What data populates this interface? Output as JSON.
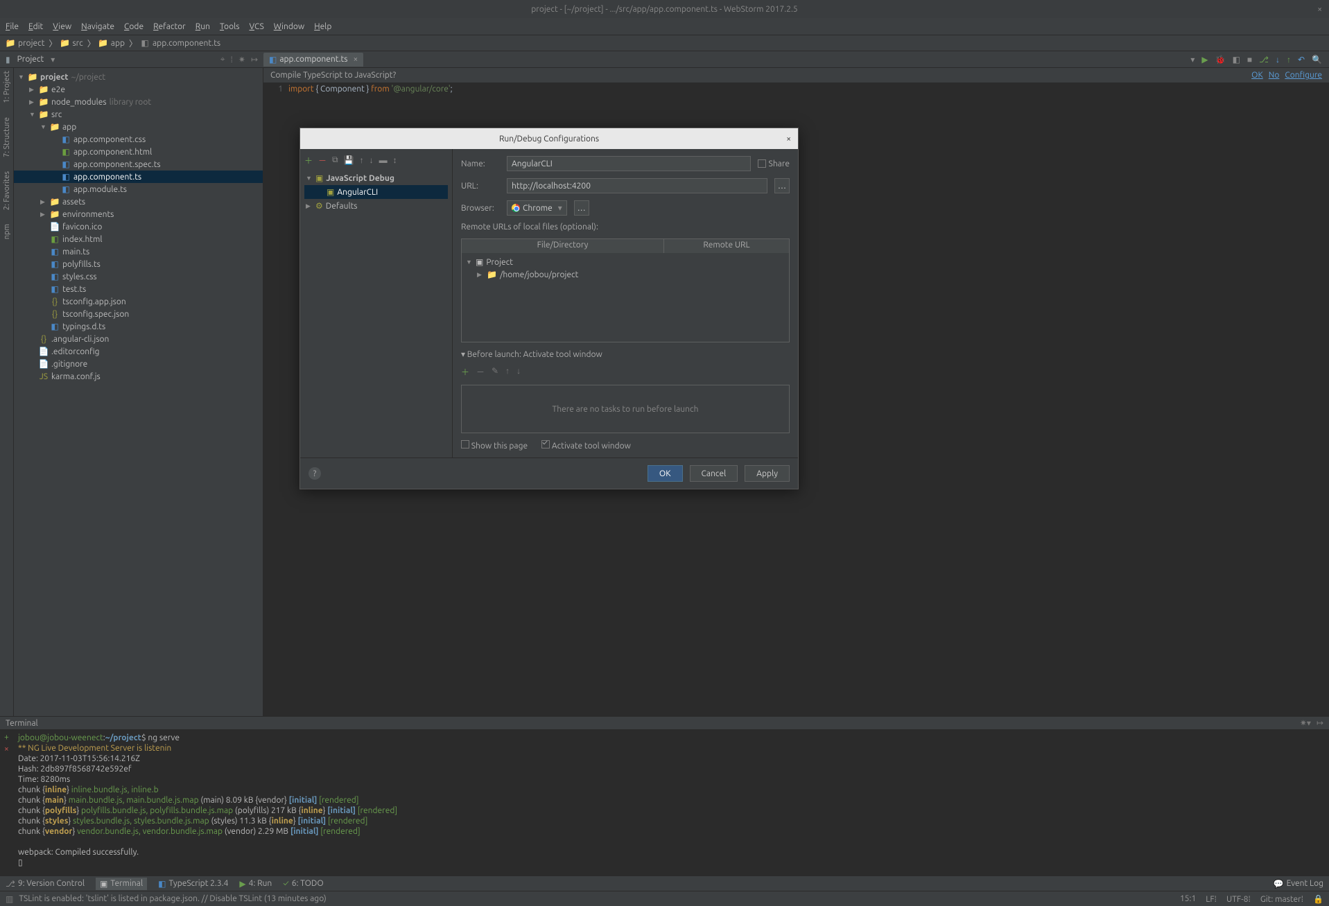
{
  "title": "project - [~/project] - .../src/app/app.component.ts - WebStorm 2017.2.5",
  "menu": [
    "File",
    "Edit",
    "View",
    "Navigate",
    "Code",
    "Refactor",
    "Run",
    "Tools",
    "VCS",
    "Window",
    "Help"
  ],
  "breadcrumbs": [
    {
      "icon": "folder",
      "label": "project"
    },
    {
      "icon": "folder",
      "label": "src"
    },
    {
      "icon": "folder",
      "label": "app"
    },
    {
      "icon": "ts",
      "label": "app.component.ts"
    }
  ],
  "project_panel_label": "Project",
  "left_gutter": [
    "1: Project",
    "7: Structure",
    "2: Favorites",
    "npm"
  ],
  "tree": {
    "root": {
      "label": "project",
      "hint": "~/project"
    },
    "items": [
      {
        "d": 1,
        "t": "folder",
        "arrow": "right",
        "label": "e2e"
      },
      {
        "d": 1,
        "t": "folder",
        "arrow": "right",
        "label": "node_modules",
        "dim": "library root"
      },
      {
        "d": 1,
        "t": "folder",
        "arrow": "down",
        "label": "src"
      },
      {
        "d": 2,
        "t": "folder",
        "arrow": "down",
        "label": "app"
      },
      {
        "d": 3,
        "t": "css",
        "label": "app.component.css"
      },
      {
        "d": 3,
        "t": "html",
        "label": "app.component.html"
      },
      {
        "d": 3,
        "t": "ts",
        "label": "app.component.spec.ts"
      },
      {
        "d": 3,
        "t": "ts",
        "label": "app.component.ts",
        "sel": true
      },
      {
        "d": 3,
        "t": "ts",
        "label": "app.module.ts"
      },
      {
        "d": 2,
        "t": "folder",
        "arrow": "right",
        "label": "assets"
      },
      {
        "d": 2,
        "t": "folder",
        "arrow": "right",
        "label": "environments"
      },
      {
        "d": 2,
        "t": "file",
        "label": "favicon.ico"
      },
      {
        "d": 2,
        "t": "html",
        "label": "index.html"
      },
      {
        "d": 2,
        "t": "ts",
        "label": "main.ts"
      },
      {
        "d": 2,
        "t": "ts",
        "label": "polyfills.ts"
      },
      {
        "d": 2,
        "t": "css",
        "label": "styles.css"
      },
      {
        "d": 2,
        "t": "ts",
        "label": "test.ts"
      },
      {
        "d": 2,
        "t": "json",
        "label": "tsconfig.app.json"
      },
      {
        "d": 2,
        "t": "json",
        "label": "tsconfig.spec.json"
      },
      {
        "d": 2,
        "t": "ts",
        "label": "typings.d.ts"
      },
      {
        "d": 1,
        "t": "json",
        "label": ".angular-cli.json"
      },
      {
        "d": 1,
        "t": "file",
        "label": ".editorconfig"
      },
      {
        "d": 1,
        "t": "file",
        "label": ".gitignore"
      },
      {
        "d": 1,
        "t": "js",
        "label": "karma.conf.js"
      }
    ]
  },
  "editor": {
    "tab": "app.component.ts",
    "compile_prompt": "Compile TypeScript to JavaScript?",
    "compile_links": [
      "OK",
      "No",
      "Configure"
    ],
    "line1_no": "1"
  },
  "terminal": {
    "title": "Terminal",
    "prompt_user": "jobou@jobou-weenect",
    "prompt_path": "~/project",
    "prompt_cmd": "ng serve"
  },
  "tools": [
    {
      "icon": "branch",
      "label": "9: Version Control"
    },
    {
      "icon": "term",
      "label": "Terminal",
      "active": true
    },
    {
      "icon": "ts",
      "label": "TypeScript 2.3.4"
    },
    {
      "icon": "run",
      "label": "4: Run"
    },
    {
      "icon": "todo",
      "label": "6: TODO"
    }
  ],
  "event_log": "Event Log",
  "status": {
    "msg": "TSLint is enabled: 'tslint' is listed in package.json. // Disable TSLint (13 minutes ago)",
    "right": [
      "15:1",
      "LF⁞",
      "UTF-8⁞",
      "Git: master⁞"
    ]
  },
  "dialog": {
    "title": "Run/Debug Configurations",
    "left_tree": [
      {
        "d": 0,
        "arrow": "down",
        "label": "JavaScript Debug",
        "bold": true,
        "icon": "js"
      },
      {
        "d": 1,
        "label": "AngularCLI",
        "sel": true,
        "icon": "js"
      },
      {
        "d": 0,
        "arrow": "right",
        "label": "Defaults",
        "icon": "gear"
      }
    ],
    "name_label": "Name:",
    "name_value": "AngularCLI",
    "share_label": "Share",
    "url_label": "URL:",
    "url_value": "http://localhost:4200",
    "browser_label": "Browser:",
    "browser_value": "Chrome",
    "remote_label": "Remote URLs of local files (optional):",
    "cols": [
      "File/Directory",
      "Remote URL"
    ],
    "rt": [
      {
        "d": 0,
        "arrow": "down",
        "icon": "proj",
        "label": "Project"
      },
      {
        "d": 1,
        "arrow": "right",
        "icon": "folder",
        "label": "/home/jobou/project"
      }
    ],
    "before_launch": "Before launch: Activate tool window",
    "bl_empty": "There are no tasks to run before launch",
    "show_page": "Show this page",
    "activate": "Activate tool window",
    "ok": "OK",
    "cancel": "Cancel",
    "apply": "Apply"
  }
}
